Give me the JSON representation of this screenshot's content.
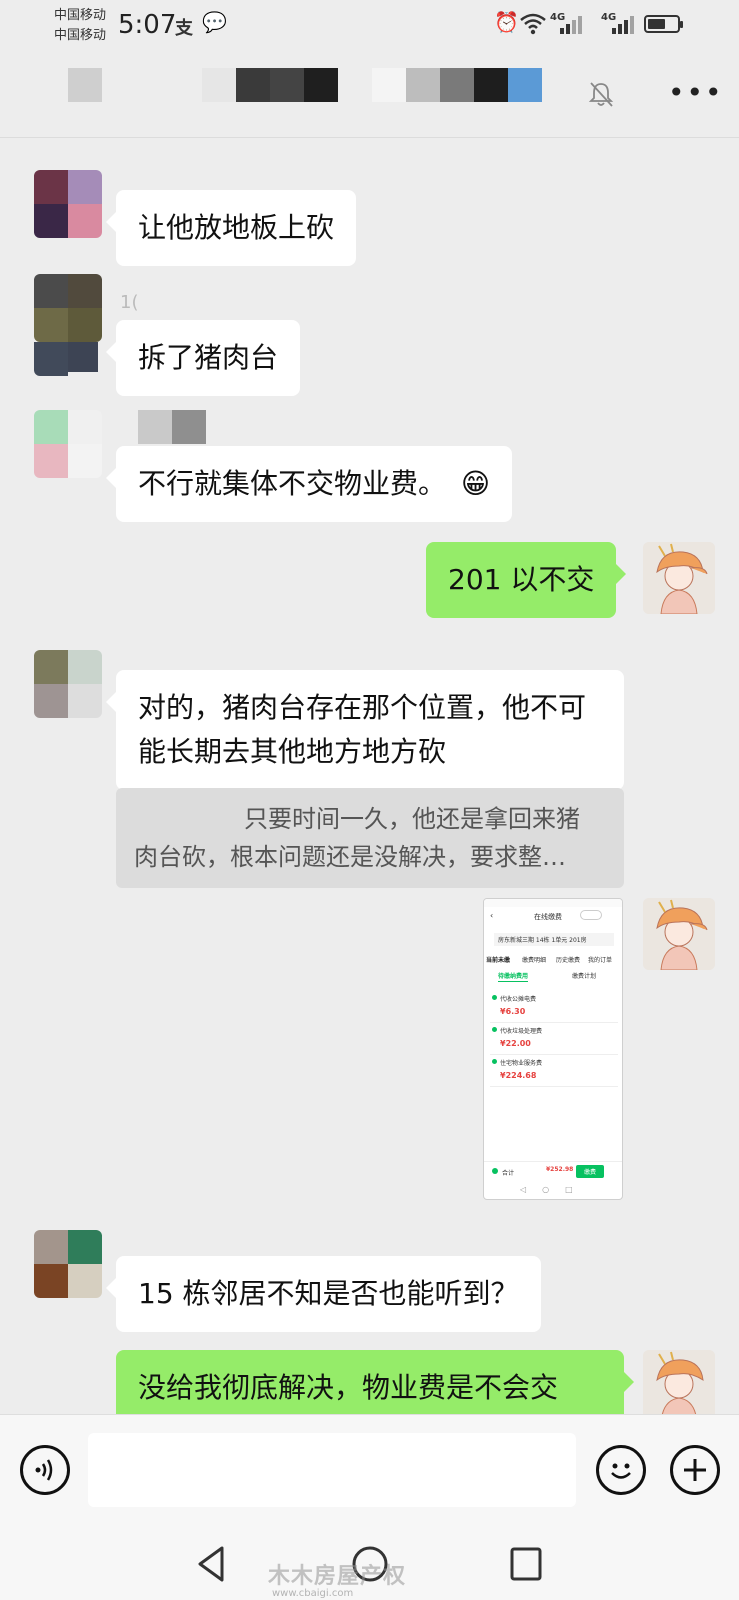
{
  "status_bar": {
    "carrier1": "中国移动",
    "carrier2": "中国移动",
    "time": "5:07",
    "net1": "4G",
    "net2": "4G",
    "battery_level": 0.6
  },
  "chat": {
    "messages": [
      {
        "text": "让他放地板上砍"
      },
      {
        "text": "拆了猪肉台"
      },
      {
        "text": "不行就集体不交物业费。"
      },
      {
        "text": "201 以不交"
      },
      {
        "text": "对的，猪肉台存在那个位置，他不可能长期去其他地方地方砍"
      },
      {
        "text": "15 栋邻居不知是否也能听到？"
      },
      {
        "text": "没给我彻底解决，物业费是不会交"
      }
    ],
    "quote_line1": "只要时间一久，他还是拿回来猪",
    "quote_line2": "肉台砍，根本问题还是没解决，要求整…",
    "sender_partial": "1(",
    "emoji": "😁"
  },
  "image_message": {
    "title": "在线缴费",
    "address": "房东新城三期 14栋 1单元 201房",
    "tabs": [
      "当前未缴",
      "缴费明细",
      "历史缴费",
      "我的订单"
    ],
    "subtab_active": "待缴纳费用",
    "subtab_other": "缴费计划",
    "items": [
      {
        "name": "代收公摊电费",
        "amount": "¥6.30"
      },
      {
        "name": "代收垃圾处理费",
        "amount": "¥22.00"
      },
      {
        "name": "住宅物业服务费",
        "amount": "¥224.68"
      }
    ],
    "total_label": "合计",
    "total": "¥252.98",
    "pay_button": "缴费"
  },
  "colors": {
    "background": "#ededed",
    "bubble_in": "#ffffff",
    "bubble_out": "#95ec69",
    "quote_bg": "#dcdcdc"
  },
  "watermark": {
    "text": "木木房屋产权",
    "url": "www.cbaigi.com"
  }
}
